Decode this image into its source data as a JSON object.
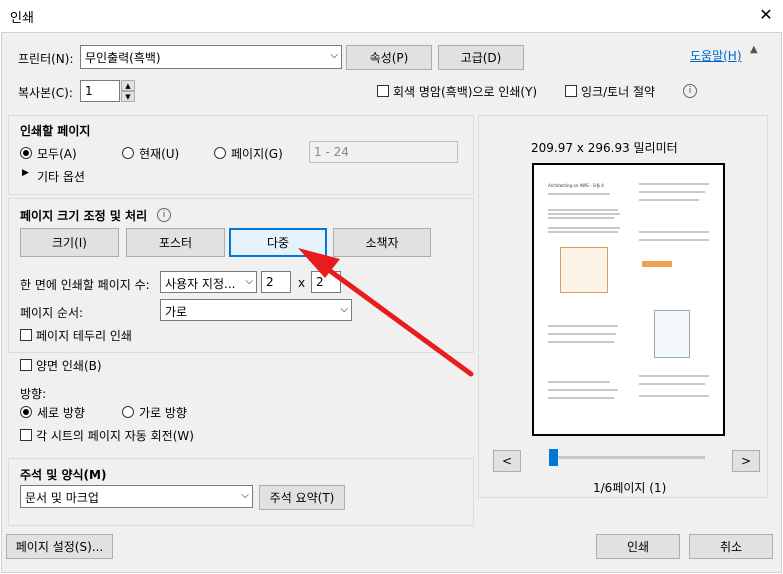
{
  "window": {
    "title": "인쇄"
  },
  "printer": {
    "label": "프린터(N):",
    "value": "무인출력(흑백)",
    "properties_btn": "속성(P)",
    "advanced_btn": "고급(D)",
    "help_link": "도움말(H)"
  },
  "copies": {
    "label": "복사본(C):",
    "value": "1",
    "grayscale_label": "회색 명암(흑백)으로 인쇄(Y)",
    "ink_save_label": "잉크/토너 절약"
  },
  "pages": {
    "title": "인쇄할 페이지",
    "all": "모두(A)",
    "current": "현재(U)",
    "pages": "페이지(G)",
    "range_placeholder": "1 - 24",
    "more_options": "기타 옵션"
  },
  "sizing": {
    "title": "페이지 크기 조정 및 처리",
    "size_btn": "크기(I)",
    "poster_btn": "포스터",
    "multiple_btn": "다중",
    "booklet_btn": "소책자",
    "pages_per_sheet_label": "한 면에 인쇄할 페이지 수:",
    "pages_per_sheet_value": "사용자 지정...",
    "cols": "2",
    "times": "x",
    "rows": "2",
    "order_label": "페이지 순서:",
    "order_value": "가로",
    "border_label": "페이지 테두리 인쇄"
  },
  "duplex": {
    "label": "양면 인쇄(B)",
    "orientation_label": "방향:",
    "portrait": "세로 방향",
    "landscape": "가로 방향",
    "auto_rotate": "각 시트의 페이지 자동 회전(W)"
  },
  "comments": {
    "title": "주석 및 양식(M)",
    "value": "문서 및 마크업",
    "summary_btn": "주석 요약(T)"
  },
  "preview": {
    "dimensions": "209.97 x 296.93 밀리미터",
    "prev": "<",
    "next": ">",
    "page_indicator": "1/6페이지 (1)",
    "slider_position": 0.0,
    "page_snippet": "Architecting on AWS - 모듈 4"
  },
  "footer": {
    "page_setup_btn": "페이지 설정(S)...",
    "print_btn": "인쇄",
    "cancel_btn": "취소"
  },
  "annotation": {
    "arrow_color": "#e81c1c"
  }
}
